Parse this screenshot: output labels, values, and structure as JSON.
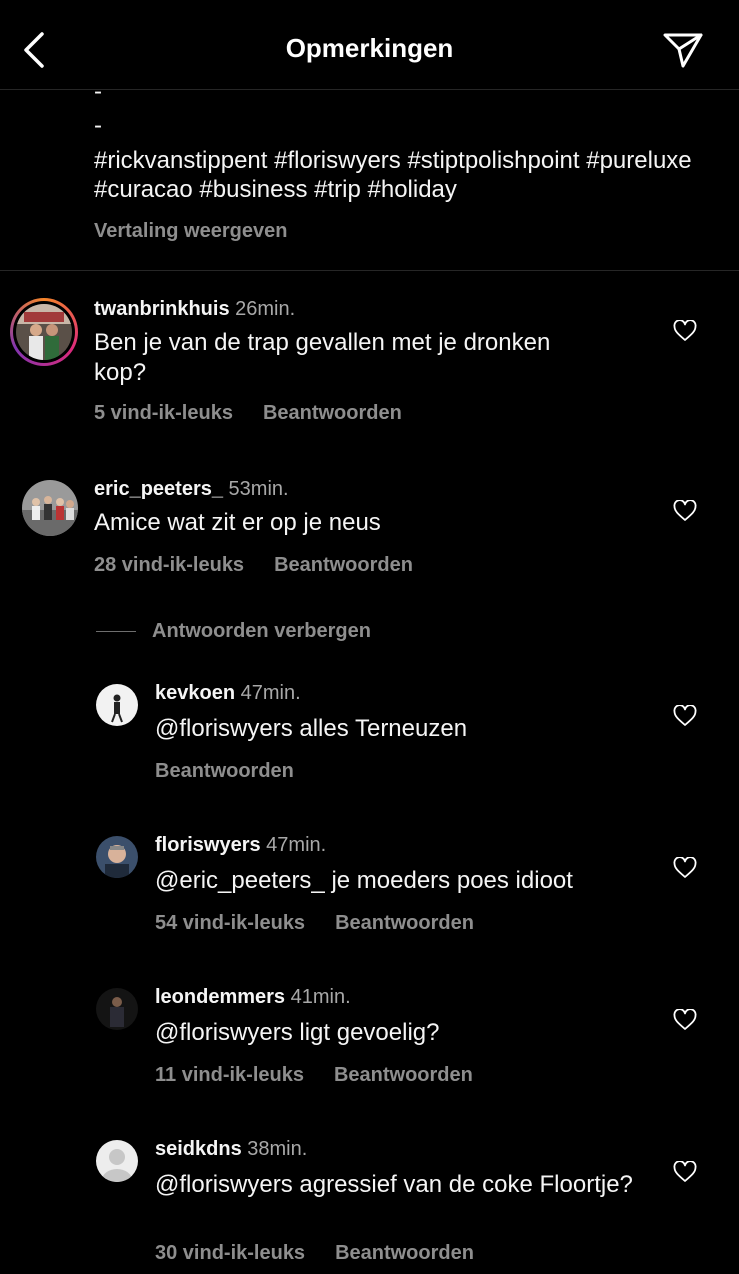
{
  "header": {
    "title": "Opmerkingen",
    "back_icon": "chevron-left-icon",
    "share_icon": "paper-plane-icon"
  },
  "caption": {
    "dash1": "-",
    "dash2": "-",
    "hashtags": "#rickvanstippent #floriswyers #stiptpolishpoint #pureluxe #curacao #business #trip #holiday",
    "translate": "Vertaling weergeven"
  },
  "comments": [
    {
      "username": "twanbrinkhuis",
      "time": "26min.",
      "text": "Ben je van de trap gevallen met je dronken kop?",
      "likes": "5 vind-ik-leuks",
      "reply": "Beantwoorden"
    },
    {
      "username": "eric_peeters_",
      "time": "53min.",
      "text": "Amice wat zit er op je neus",
      "likes": "28 vind-ik-leuks",
      "reply": "Beantwoorden"
    }
  ],
  "hide_replies": "Antwoorden verbergen",
  "replies": [
    {
      "username": "kevkoen",
      "time": "47min.",
      "text": "@floriswyers alles Terneuzen",
      "reply": "Beantwoorden"
    },
    {
      "username": "floriswyers",
      "time": "47min.",
      "text": "@eric_peeters_ je moeders poes idioot",
      "likes": "54 vind-ik-leuks",
      "reply": "Beantwoorden"
    },
    {
      "username": "leondemmers",
      "time": "41min.",
      "text": "@floriswyers ligt gevoelig?",
      "likes": "11 vind-ik-leuks",
      "reply": "Beantwoorden"
    },
    {
      "username": "seidkdns",
      "time": "38min.",
      "text": "@floriswyers agressief van de coke Floortje?",
      "likes": "30 vind-ik-leuks",
      "reply": "Beantwoorden"
    }
  ]
}
